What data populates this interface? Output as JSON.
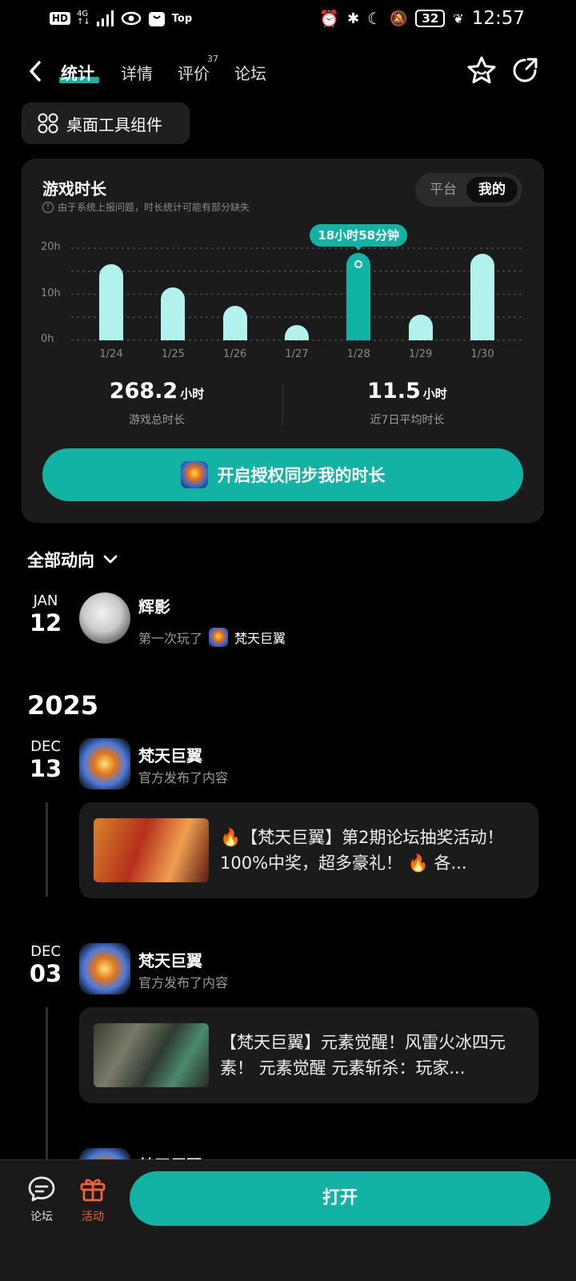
{
  "status_bar": {
    "hd": "HD",
    "network": "4G",
    "network_sub": "↑↓",
    "top_label": "Top",
    "battery": "32",
    "time": "12:57"
  },
  "nav": {
    "tabs": [
      {
        "label": "统计",
        "active": true
      },
      {
        "label": "详情",
        "active": false
      },
      {
        "label": "评价",
        "active": false
      },
      {
        "label": "论坛",
        "active": false
      }
    ],
    "review_count": "37"
  },
  "widget_button": {
    "label": "桌面工具组件"
  },
  "stats": {
    "title": "游戏时长",
    "notice": "由于系统上报问题，时长统计可能有部分缺失",
    "segment": {
      "options": [
        "平台",
        "我的"
      ],
      "selected": "我的"
    },
    "total": {
      "value": "268.2",
      "unit": "小时",
      "label": "游戏总时长"
    },
    "average": {
      "value": "11.5",
      "unit": "小时",
      "label": "近7日平均时长"
    },
    "sync_button": "开启授权同步我的时长"
  },
  "chart_data": {
    "type": "bar",
    "categories": [
      "1/24",
      "1/25",
      "1/26",
      "1/27",
      "1/28",
      "1/29",
      "1/30"
    ],
    "values": [
      16.5,
      11.5,
      7.5,
      3.3,
      18.97,
      5.5,
      18.8
    ],
    "y_ticks": [
      "0h",
      "10h",
      "20h"
    ],
    "ylim": [
      0,
      20
    ],
    "ylabel": "",
    "xlabel": "",
    "selected_index": 4,
    "tooltip": "18小时58分钟",
    "grid": true,
    "colors": {
      "bar": "#b3f2ec",
      "selected": "#12b3a4"
    }
  },
  "feed": {
    "filter_label": "全部动向",
    "entries": [
      {
        "month": "JAN",
        "day": "12",
        "name": "辉影",
        "desc": "第一次玩了",
        "game": "梵天巨翼"
      }
    ],
    "year": "2025",
    "posts": [
      {
        "month": "DEC",
        "day": "13",
        "name": "梵天巨翼",
        "desc": "官方发布了内容",
        "text": "🔥【梵天巨翼】第2期论坛抽奖活动！100%中奖，超多豪礼！ 🔥 各..."
      },
      {
        "month": "DEC",
        "day": "03",
        "name": "梵天巨翼",
        "desc": "官方发布了内容",
        "text": "【梵天巨翼】元素觉醒！风雷火冰四元素！ 元素觉醒 元素斩杀：玩家..."
      }
    ],
    "partial_name": "梵天巨翼"
  },
  "bottom_bar": {
    "forum": "论坛",
    "activity": "活动",
    "open": "打开"
  },
  "colors": {
    "accent": "#12b3a4",
    "bar_light": "#b3f2ec",
    "card_bg": "#1b1b1b",
    "activity": "#f0623a"
  }
}
